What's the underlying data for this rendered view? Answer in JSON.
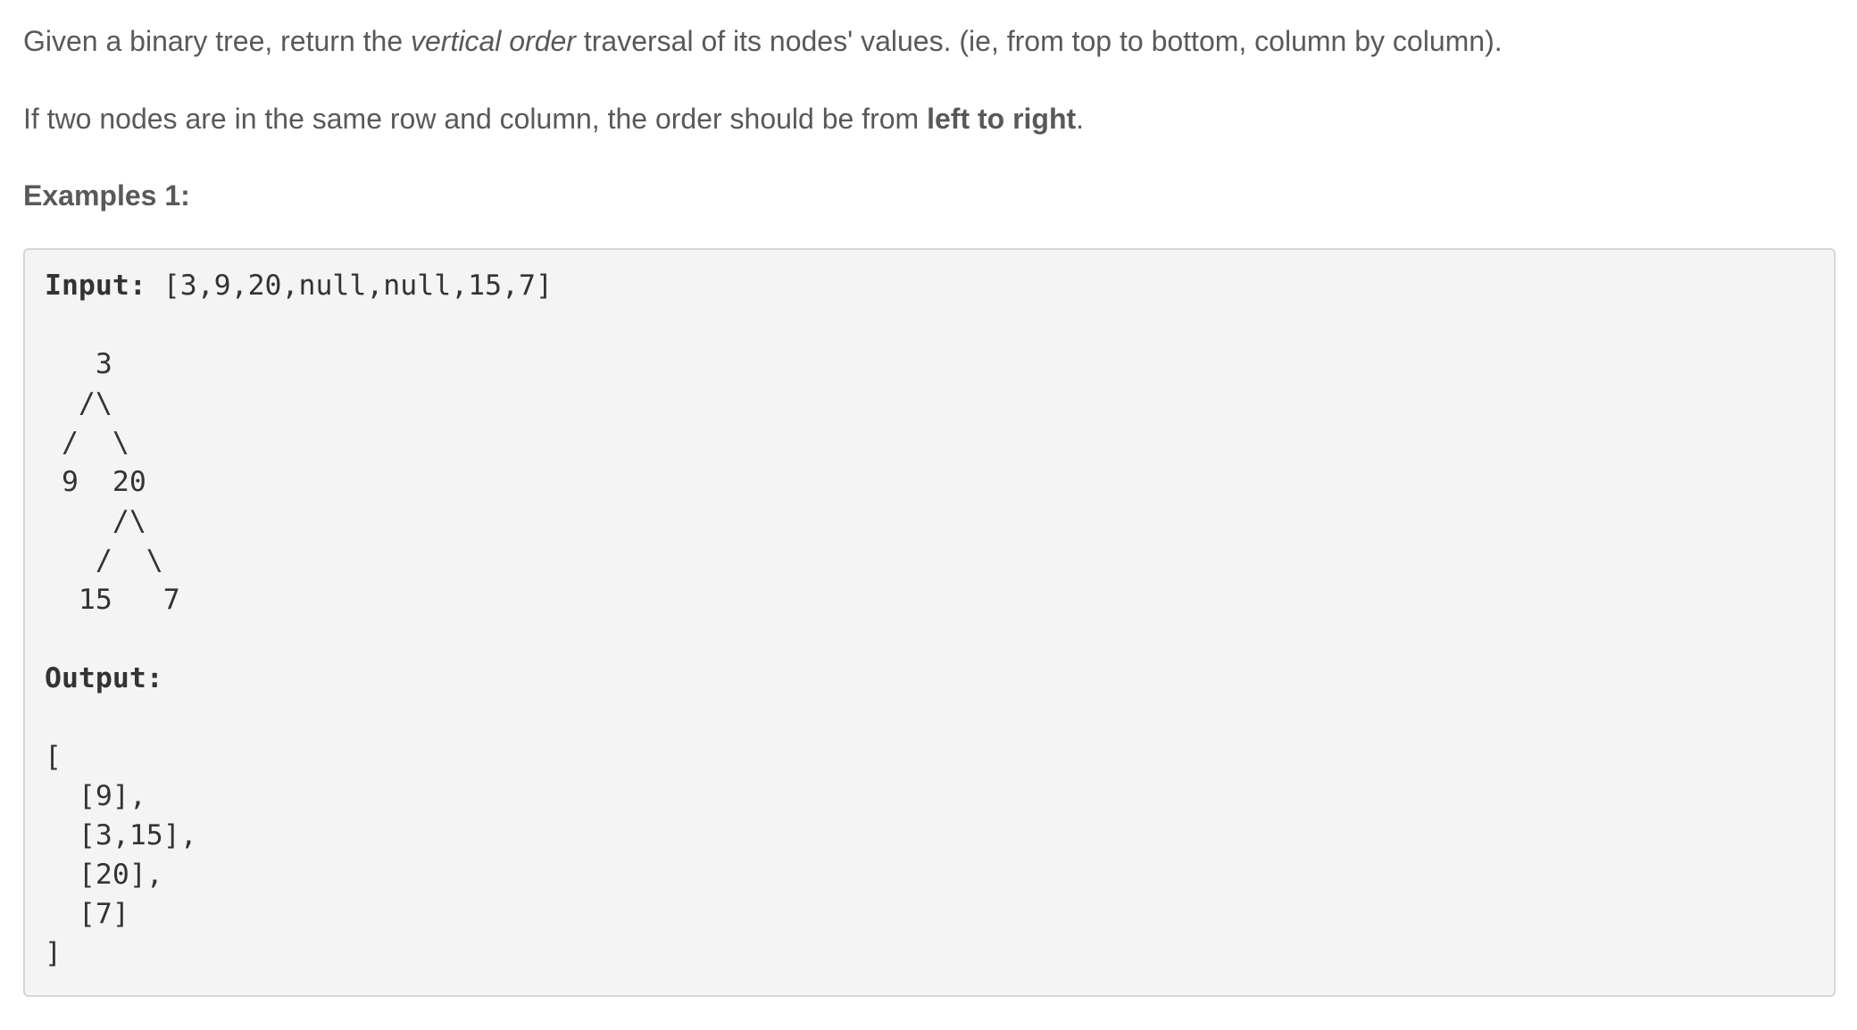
{
  "intro": {
    "p1_before": "Given a binary tree, return the ",
    "p1_em": "vertical order",
    "p1_after": " traversal of its nodes' values. (ie, from top to bottom, column by column).",
    "p2_before": "If two nodes are in the same row and column, the order should be from ",
    "p2_strong": "left to right",
    "p2_after": "."
  },
  "example": {
    "heading": "Examples 1:",
    "input_label": "Input:",
    "input_value": " [3,9,20,null,null,15,7]",
    "tree_lines": [
      "   3",
      "  /\\",
      " /  \\",
      " 9  20",
      "    /\\",
      "   /  \\",
      "  15   7"
    ],
    "output_label": "Output:",
    "output_lines": [
      "[",
      "  [9],",
      "  [3,15],",
      "  [20],",
      "  [7]",
      "]"
    ]
  }
}
